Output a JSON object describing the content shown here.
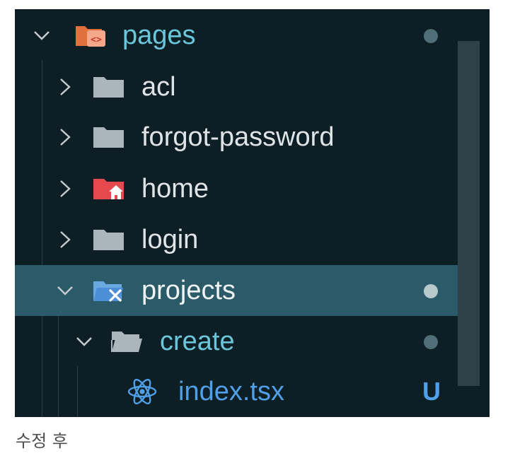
{
  "explorer": {
    "rows": [
      {
        "name": "pages",
        "expanded": true,
        "icon": "folder-open-code-icon",
        "status": "dot",
        "selected": false
      },
      {
        "name": "acl",
        "expanded": false,
        "icon": "folder-icon",
        "selected": false
      },
      {
        "name": "forgot-password",
        "expanded": false,
        "icon": "folder-icon",
        "selected": false
      },
      {
        "name": "home",
        "expanded": false,
        "icon": "folder-home-icon",
        "selected": false
      },
      {
        "name": "login",
        "expanded": false,
        "icon": "folder-icon",
        "selected": false
      },
      {
        "name": "projects",
        "expanded": true,
        "icon": "folder-tools-icon",
        "status": "dot",
        "selected": true
      },
      {
        "name": "create",
        "expanded": true,
        "icon": "folder-open-icon",
        "status": "dot",
        "selected": false
      },
      {
        "name": "index.tsx",
        "icon": "react-icon",
        "status": "U",
        "selected": false
      }
    ],
    "colors": {
      "panel_bg": "#0d1f25",
      "selected_bg": "#2b5a68",
      "folder_text": "#dfe4e6",
      "pages_text": "#6bc6dc",
      "create_text": "#6bc6dc",
      "file_text": "#4fa0e8",
      "modified_dot": "#4e6f76",
      "untracked": "#4fa0e8"
    }
  },
  "caption": "수정 후"
}
